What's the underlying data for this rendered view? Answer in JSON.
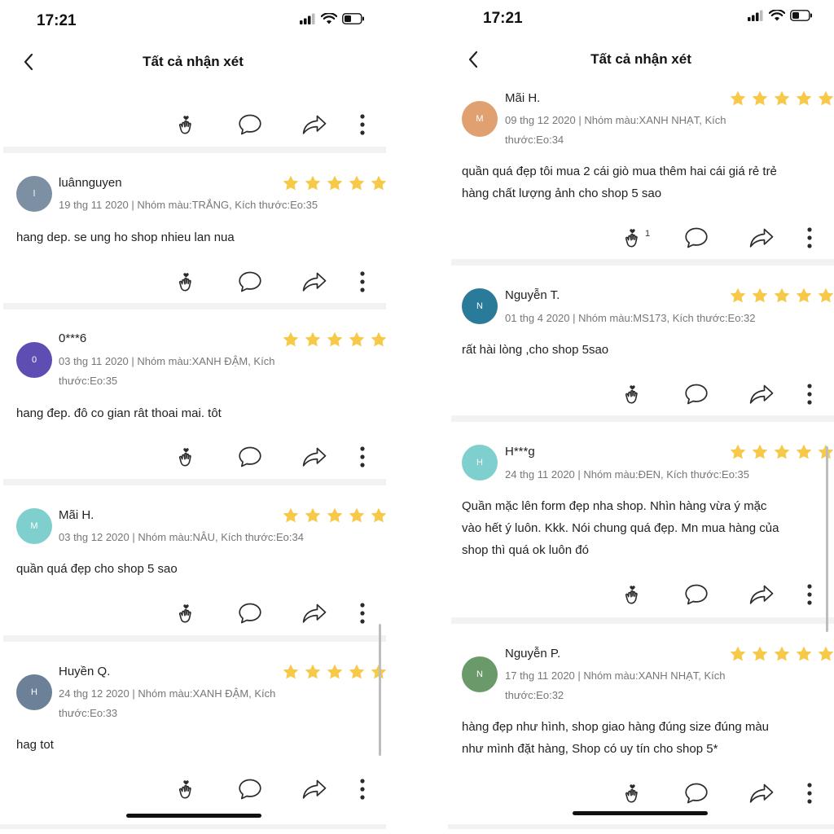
{
  "status": {
    "time": "17:21"
  },
  "nav": {
    "title": "Tất cả nhận xét"
  },
  "colors": {
    "star": "#F7C948",
    "icon": "#2b2b2b",
    "divider": "#f2f2f2"
  },
  "left": {
    "reviews": [
      {
        "initial": "l",
        "avatar_color": "#7C8FA3",
        "name": "luânnguyen",
        "rating": 5,
        "meta": [
          "19 thg 11 2020 | Nhóm màu:TRẮNG, Kích thước:Eo:35"
        ],
        "body": [
          "hang dep. se ung ho shop nhieu lan nua"
        ]
      },
      {
        "initial": "0",
        "avatar_color": "#5E4DB2",
        "name": "0***6",
        "rating": 5,
        "meta": [
          "03 thg 11 2020 | Nhóm màu:XANH ĐẬM, Kích",
          "thước:Eo:35"
        ],
        "body": [
          "hang đep. đô co gian rât thoai mai. tôt"
        ]
      },
      {
        "initial": "M",
        "avatar_color": "#7FCFCF",
        "name": "Mãi H.",
        "rating": 5,
        "meta": [
          "03 thg 12 2020 | Nhóm màu:NÂU, Kích thước:Eo:34"
        ],
        "body": [
          "quần quá đẹp cho shop 5 sao"
        ]
      },
      {
        "initial": "H",
        "avatar_color": "#6C8197",
        "name": "Huyền Q.",
        "rating": 5,
        "meta": [
          "24 thg 12 2020 | Nhóm màu:XANH ĐẬM, Kích",
          "thước:Eo:33"
        ],
        "body": [
          "hag tot"
        ]
      }
    ]
  },
  "right": {
    "reviews": [
      {
        "initial": "M",
        "avatar_color": "#E0A070",
        "name": "Mãi H.",
        "rating": 5,
        "meta": [
          "09 thg 12 2020 | Nhóm màu:XANH NHẠT, Kích",
          "thước:Eo:34"
        ],
        "body": [
          "quần quá đẹp tôi mua 2 cái giò mua thêm hai cái giá rẻ trẻ",
          "hàng chất lượng ảnh cho shop 5 sao"
        ],
        "like_count": "1"
      },
      {
        "initial": "N",
        "avatar_color": "#2A7A9A",
        "name": "Nguyễn T.",
        "rating": 5,
        "meta": [
          "01 thg 4 2020 | Nhóm màu:MS173, Kích thước:Eo:32"
        ],
        "body": [
          "rất hài lòng ,cho shop 5sao"
        ]
      },
      {
        "initial": "H",
        "avatar_color": "#7FCFCF",
        "name": "H***g",
        "rating": 5,
        "meta": [
          "24 thg 11 2020 | Nhóm màu:ĐEN, Kích thước:Eo:35"
        ],
        "body": [
          "Quần mặc lên form đẹp nha shop. Nhìn hàng vừa ý mặc",
          "vào hết ý luôn. Kkk. Nói chung quá đẹp. Mn mua hàng của",
          "shop thì quá ok luôn đó"
        ]
      },
      {
        "initial": "N",
        "avatar_color": "#6A9A6A",
        "name": "Nguyễn P.",
        "rating": 5,
        "meta": [
          "17 thg 11 2020 | Nhóm màu:XANH NHẠT, Kích",
          "thước:Eo:32"
        ],
        "body": [
          "hàng đẹp như hình, shop giao hàng đúng size đúng màu",
          "như mình đặt hàng, Shop có uy tín cho shop 5*"
        ]
      }
    ]
  },
  "icons": {
    "back": "chevron-left-icon",
    "like": "heart-hand-icon",
    "comment": "comment-bubble-icon",
    "share": "share-arrow-icon",
    "more": "more-vertical-icon",
    "star": "star-icon",
    "signal": "signal-icon",
    "wifi": "wifi-icon",
    "battery": "battery-icon"
  }
}
